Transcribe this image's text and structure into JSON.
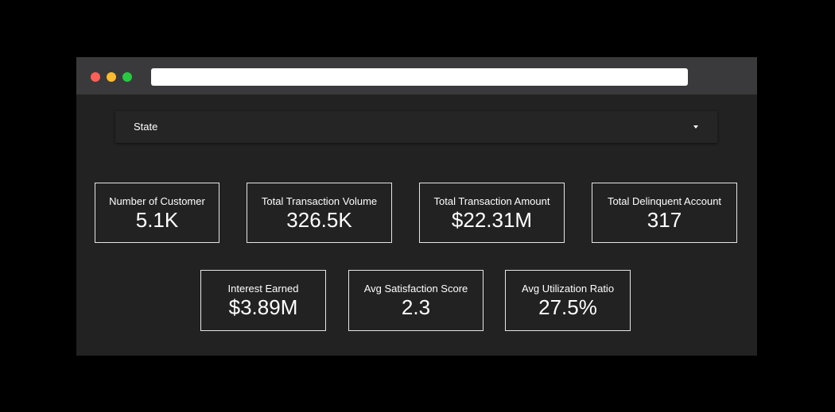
{
  "browser": {
    "window_controls": {
      "close_color": "#ff5f57",
      "minimize_color": "#febc2e",
      "maximize_color": "#28c840"
    },
    "address_bar": {
      "value": ""
    }
  },
  "filters": {
    "state_slicer": {
      "label": "State",
      "icon": "chevron-down-icon"
    }
  },
  "kpis": {
    "row1": [
      {
        "title": "Number of Customer",
        "value": "5.1K"
      },
      {
        "title": "Total Transaction Volume",
        "value": "326.5K"
      },
      {
        "title": "Total Transaction Amount",
        "value": "$22.31M"
      },
      {
        "title": "Total Delinquent Account",
        "value": "317"
      }
    ],
    "row2": [
      {
        "title": "Interest Earned",
        "value": "$3.89M"
      },
      {
        "title": "Avg Satisfaction Score",
        "value": "2.3"
      },
      {
        "title": "Avg Utilization Ratio",
        "value": "27.5%"
      }
    ]
  },
  "colors": {
    "page_background": "#000000",
    "titlebar": "#3a3a3c",
    "dashboard_background": "#222222",
    "card_border": "#e6e6e6",
    "text": "#ffffff"
  }
}
